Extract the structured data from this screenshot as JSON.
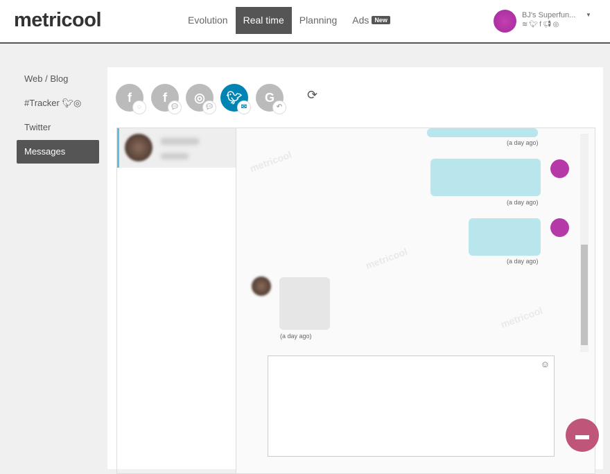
{
  "header": {
    "logo": "metricool",
    "nav": [
      {
        "label": "Evolution"
      },
      {
        "label": "Real time",
        "active": true
      },
      {
        "label": "Planning"
      },
      {
        "label": "Ads",
        "badge": "New"
      }
    ],
    "user": {
      "name": "BJ's Superfun...",
      "icons": [
        "rss-icon",
        "twitter-icon",
        "facebook-icon",
        "megaphone-icon",
        "instagram-icon"
      ]
    }
  },
  "sidebar": {
    "items": [
      {
        "label": "Web / Blog"
      },
      {
        "label": "#Tracker"
      },
      {
        "label": "Twitter"
      },
      {
        "label": "Messages",
        "active": true
      }
    ]
  },
  "networks": [
    {
      "name": "facebook-messenger",
      "selected": false
    },
    {
      "name": "facebook-comments",
      "selected": false
    },
    {
      "name": "instagram-comments",
      "selected": false
    },
    {
      "name": "twitter-dm",
      "selected": true
    },
    {
      "name": "google-reviews",
      "selected": false
    }
  ],
  "colors": {
    "twitter": "#0084b4",
    "accent": "#c0557a",
    "bubble": "#b8e6ec"
  },
  "chat": {
    "timestamps": [
      "(a day ago)",
      "(a day ago)",
      "(a day ago)",
      "(a day ago)"
    ],
    "watermark": "metricool"
  }
}
